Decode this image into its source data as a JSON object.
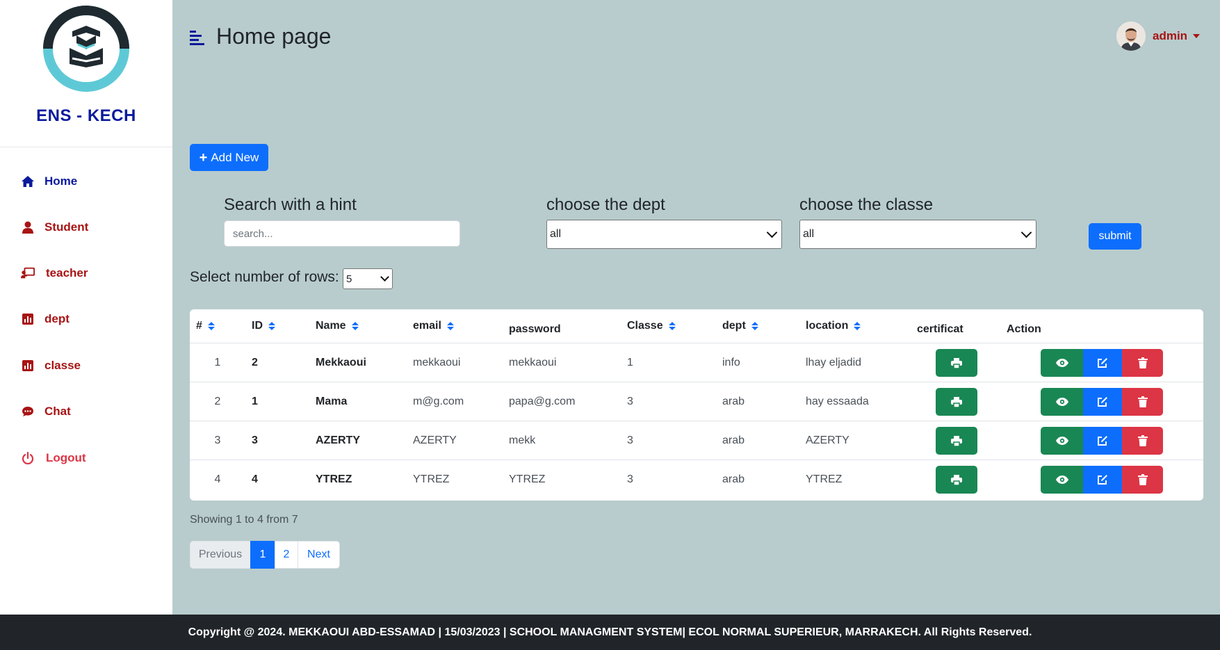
{
  "brand": "ENS - KECH",
  "sidebar": {
    "items": [
      {
        "label": "Home",
        "icon": "home-icon"
      },
      {
        "label": "Student",
        "icon": "user-icon"
      },
      {
        "label": "teacher",
        "icon": "chalkboard-teacher-icon"
      },
      {
        "label": "dept",
        "icon": "chart-icon"
      },
      {
        "label": "classe",
        "icon": "chart-icon"
      },
      {
        "label": "Chat",
        "icon": "chat-bubble-icon"
      },
      {
        "label": "Logout",
        "icon": "power-icon"
      }
    ]
  },
  "header": {
    "title": "Home page",
    "user": "admin"
  },
  "toolbar": {
    "add_label": "Add New"
  },
  "filters": {
    "search_label": "Search with a hint",
    "search_placeholder": "search...",
    "dept_label": "choose the dept",
    "dept_value": "all",
    "classe_label": "choose the classe",
    "classe_value": "all",
    "submit_label": "submit",
    "rows_label": "Select number of rows:",
    "rows_value": "5"
  },
  "table": {
    "columns": [
      "#",
      "ID",
      "Name",
      "email",
      "password",
      "Classe",
      "dept",
      "location",
      "certificat",
      "Action"
    ],
    "rows": [
      {
        "n": "1",
        "id": "2",
        "name": "Mekkaoui",
        "email": "mekkaoui",
        "password": "mekkaoui",
        "classe": "1",
        "dept": "info",
        "location": "lhay eljadid"
      },
      {
        "n": "2",
        "id": "1",
        "name": "Mama",
        "email": "m@g.com",
        "password": "papa@g.com",
        "classe": "3",
        "dept": "arab",
        "location": "hay essaada"
      },
      {
        "n": "3",
        "id": "3",
        "name": "AZERTY",
        "email": "AZERTY",
        "password": "mekk",
        "classe": "3",
        "dept": "arab",
        "location": "AZERTY"
      },
      {
        "n": "4",
        "id": "4",
        "name": "YTREZ",
        "email": "YTREZ",
        "password": "YTREZ",
        "classe": "3",
        "dept": "arab",
        "location": "YTREZ"
      }
    ]
  },
  "pagination": {
    "showing": "Showing 1 to 4 from 7",
    "prev": "Previous",
    "pages": [
      "1",
      "2"
    ],
    "next": "Next"
  },
  "footer": "Copyright @ 2024. MEKKAOUI ABD-ESSAMAD | 15/03/2023 | SCHOOL MANAGMENT SYSTEM| ECOL NORMAL SUPERIEUR, MARRAKECH. All Rights Reserved.",
  "colors": {
    "accent": "#0d6efd",
    "success": "#198754",
    "danger": "#dc3545",
    "brand_navy": "#0b1a9c",
    "nav_red": "#a81414",
    "page_bg": "#b8cccd"
  }
}
